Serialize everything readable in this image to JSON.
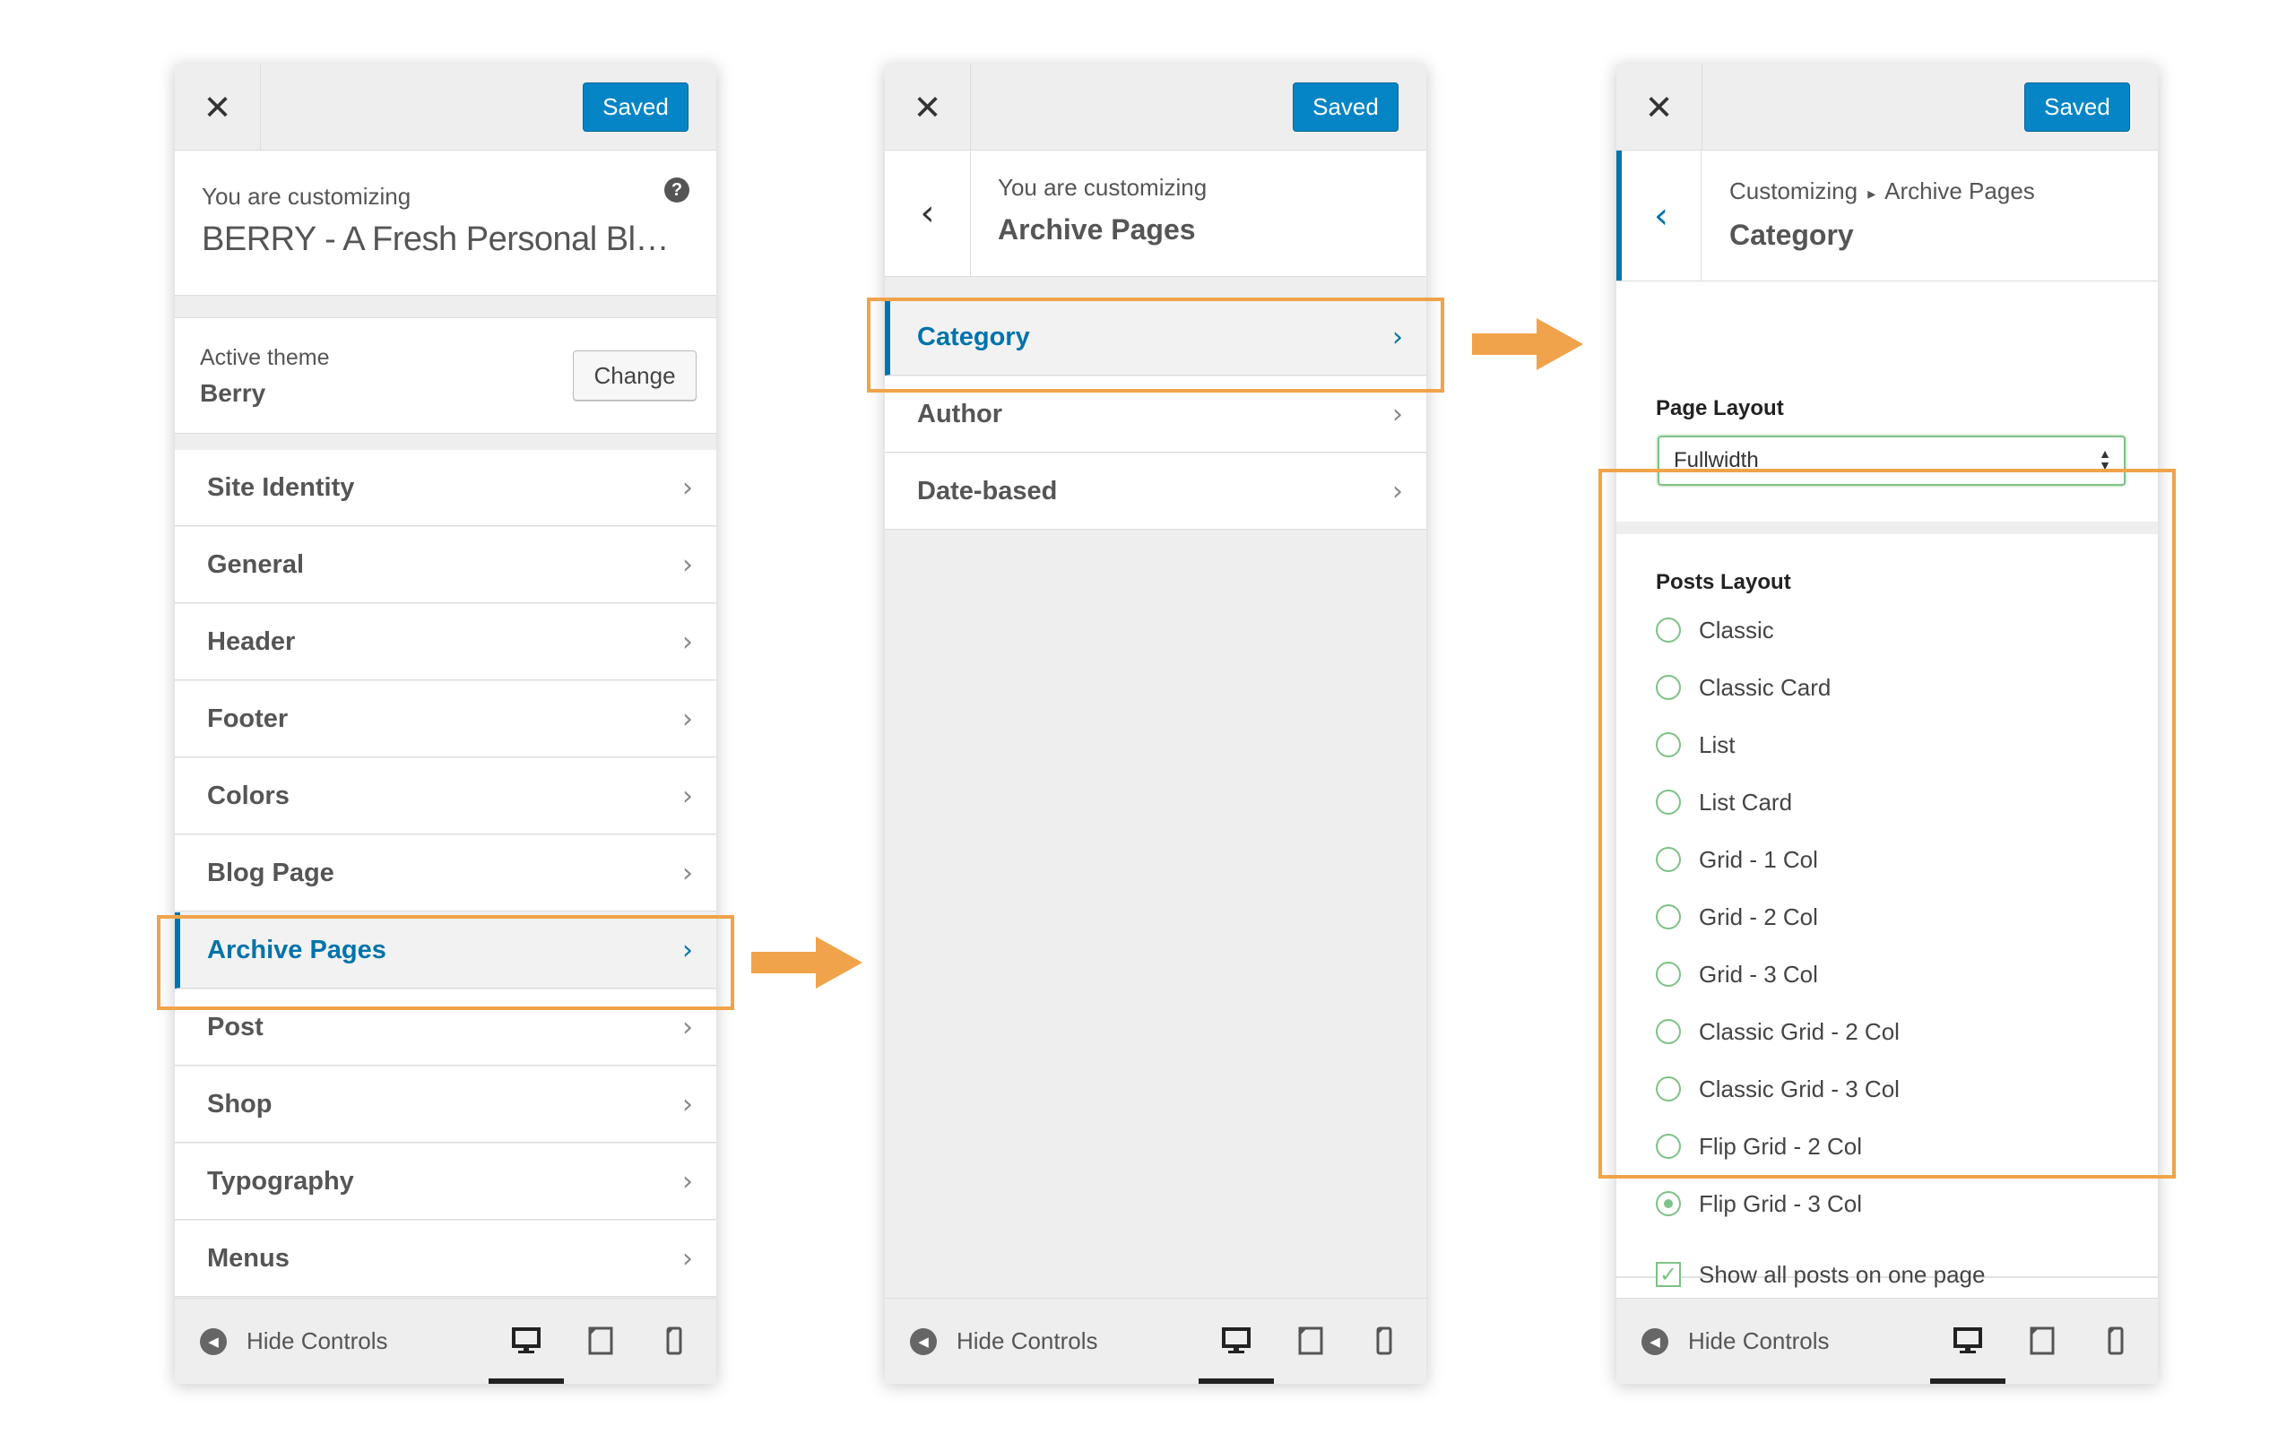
{
  "colors": {
    "accent": "#0073aa",
    "saved": "#0685c6",
    "highlight": "#f0a34a",
    "radio": "#7ec286"
  },
  "icons": {
    "close": "close-icon",
    "back": "chevron-left-icon",
    "help": "question-icon",
    "chevron": "chevron-right-icon",
    "hide": "collapse-icon"
  },
  "common": {
    "close": "✕",
    "saved": "Saved",
    "chev": "›",
    "back": "‹",
    "hide_controls": "Hide Controls"
  },
  "panel1": {
    "subtitle": "You are customizing",
    "title": "BERRY - A Fresh Personal Bl…",
    "help": "?",
    "theme_label": "Active theme",
    "theme_name": "Berry",
    "change": "Change",
    "menu": [
      "Site Identity",
      "General",
      "Header",
      "Footer",
      "Colors",
      "Blog Page",
      "Archive Pages",
      "Post",
      "Shop",
      "Typography",
      "Menus"
    ],
    "active_item": "Archive Pages"
  },
  "panel2": {
    "subtitle": "You are customizing",
    "title": "Archive Pages",
    "menu": [
      "Category",
      "Author",
      "Date-based"
    ],
    "active_item": "Category"
  },
  "panel3": {
    "breadcrumb_root": "Customizing",
    "breadcrumb_sep": "▸",
    "breadcrumb_parent": "Archive Pages",
    "title": "Category",
    "page_layout_label": "Page Layout",
    "page_layout_value": "Fullwidth",
    "posts_layout_label": "Posts Layout",
    "posts_layout_options": [
      "Classic",
      "Classic Card",
      "List",
      "List Card",
      "Grid - 1 Col",
      "Grid - 2 Col",
      "Grid - 3 Col",
      "Classic Grid - 2 Col",
      "Classic Grid - 3 Col",
      "Flip Grid - 2 Col",
      "Flip Grid - 3 Col"
    ],
    "posts_layout_selected": "Flip Grid - 3 Col",
    "show_all_label": "Show all posts on one page",
    "show_all_checked": true,
    "check_mark": "✓"
  }
}
